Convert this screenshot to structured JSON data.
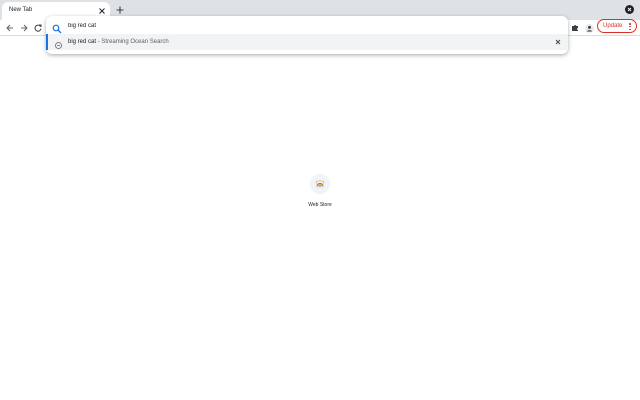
{
  "browser": {
    "tab": {
      "title": "New Tab"
    },
    "window_close_icon": "close-icon"
  },
  "toolbar": {
    "update_label": "Update"
  },
  "omnibox": {
    "query": "big red cat",
    "suggestions": [
      {
        "query": "big red cat",
        "separator": " - ",
        "source": "Streaming Ocean Search"
      }
    ]
  },
  "shortcuts": [
    {
      "label": "Web Store"
    }
  ],
  "colors": {
    "accent": "#1a73e8",
    "update_red": "#d93025",
    "tabstrip": "#dee1e6"
  }
}
